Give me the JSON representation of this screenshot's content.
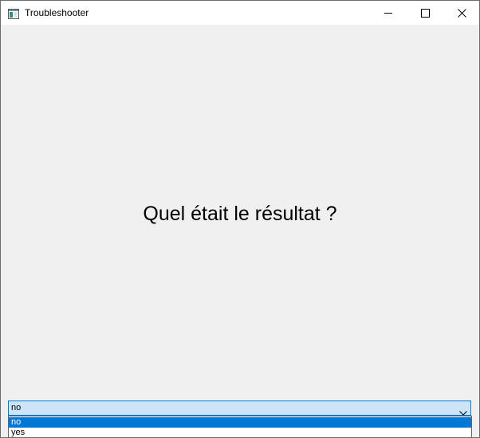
{
  "window": {
    "title": "Troubleshooter",
    "icons": {
      "app": "app-window-icon",
      "minimize": "minimize-icon",
      "maximize": "maximize-icon",
      "close": "close-icon"
    }
  },
  "main": {
    "question": "Quel était le résultat ?"
  },
  "answer_combo": {
    "selected_value": "no",
    "icon": "chevron-down-icon",
    "options": [
      "no",
      "yes"
    ],
    "highlighted_option": "no"
  },
  "colors": {
    "background": "#f0f0f0",
    "titlebar": "#ffffff",
    "combo_fill": "#cce4f7",
    "accent": "#0078d7"
  }
}
